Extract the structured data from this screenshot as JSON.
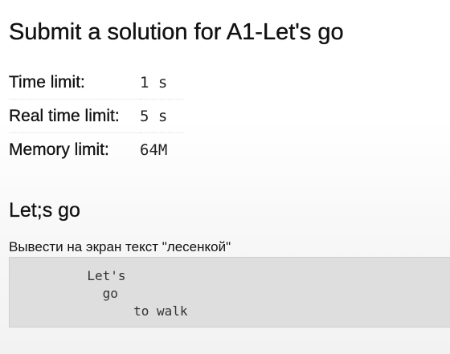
{
  "page": {
    "title": "Submit a solution for A1-Let's go"
  },
  "limits": [
    {
      "label": "Time limit:",
      "value": "1 s"
    },
    {
      "label": "Real time limit:",
      "value": "5 s"
    },
    {
      "label": "Memory limit:",
      "value": "64M"
    }
  ],
  "problem": {
    "section_title": "Let;s go",
    "statement": "Вывести на экран текст \"лесенкой\"",
    "example_lines": [
      "          Let's",
      "            go",
      "                to walk"
    ]
  }
}
